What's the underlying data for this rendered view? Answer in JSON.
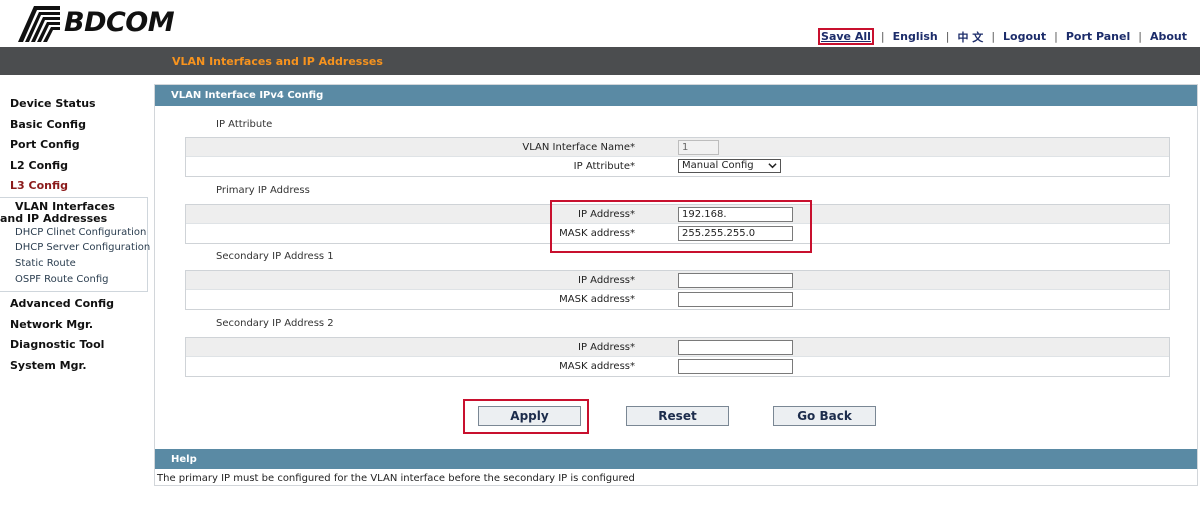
{
  "brand": {
    "name": "BDCOM"
  },
  "toplinks": {
    "save_all": "Save All",
    "english": "English",
    "chinese": "中 文",
    "logout": "Logout",
    "port_panel": "Port Panel",
    "about": "About",
    "separator": "|"
  },
  "header_bar": {
    "title": "VLAN Interfaces and IP Addresses"
  },
  "sidebar": {
    "items": [
      {
        "label": "Device Status"
      },
      {
        "label": "Basic Config"
      },
      {
        "label": "Port Config"
      },
      {
        "label": "L2 Config"
      },
      {
        "label": "L3 Config"
      }
    ],
    "submenu": {
      "active": "VLAN Interfaces and IP Addresses",
      "items": [
        {
          "label": "DHCP Clinet Configuration"
        },
        {
          "label": "DHCP Server Configuration"
        },
        {
          "label": "Static Route"
        },
        {
          "label": "OSPF Route Config"
        }
      ]
    },
    "items_after": [
      {
        "label": "Advanced Config"
      },
      {
        "label": "Network Mgr."
      },
      {
        "label": "Diagnostic Tool"
      },
      {
        "label": "System Mgr."
      }
    ]
  },
  "panel": {
    "title": "VLAN Interface IPv4 Config",
    "ip_attribute": {
      "section": "IP Attribute",
      "name_label": "VLAN Interface Name*",
      "name_value": "1",
      "attr_label": "IP Attribute*",
      "attr_value": "Manual Config"
    },
    "primary": {
      "section": "Primary IP Address",
      "ip_label": "IP Address*",
      "ip_value": "192.168.",
      "mask_label": "MASK address*",
      "mask_value": "255.255.255.0"
    },
    "secondary1": {
      "section": "Secondary IP Address 1",
      "ip_label": "IP Address*",
      "ip_value": "",
      "mask_label": "MASK address*",
      "mask_value": ""
    },
    "secondary2": {
      "section": "Secondary IP Address 2",
      "ip_label": "IP Address*",
      "ip_value": "",
      "mask_label": "MASK address*",
      "mask_value": ""
    },
    "buttons": {
      "apply": "Apply",
      "reset": "Reset",
      "go_back": "Go Back"
    }
  },
  "help": {
    "title": "Help",
    "text": "The primary IP must be configured for the VLAN interface before the secondary IP is configured"
  },
  "colors": {
    "top_bar": "#4b4d4f",
    "header_text": "#f7931e",
    "panel_header": "#5a8aa4",
    "highlight_box": "#c8102e",
    "active_nav": "#8b1a1a"
  }
}
